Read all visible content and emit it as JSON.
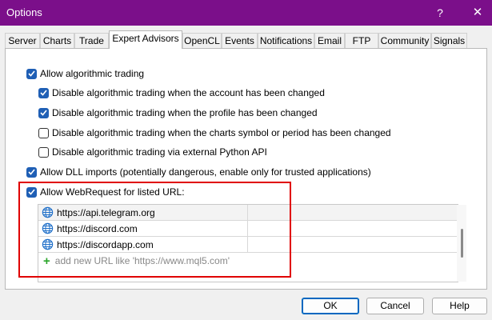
{
  "window": {
    "title": "Options",
    "help_glyph": "?",
    "close_glyph": "✕"
  },
  "tabs": [
    {
      "label": "Server"
    },
    {
      "label": "Charts"
    },
    {
      "label": "Trade"
    },
    {
      "label": "Expert Advisors",
      "active": true
    },
    {
      "label": "OpenCL"
    },
    {
      "label": "Events"
    },
    {
      "label": "Notifications"
    },
    {
      "label": "Email"
    },
    {
      "label": "FTP"
    },
    {
      "label": "Community"
    },
    {
      "label": "Signals"
    }
  ],
  "options": {
    "allow_algo": {
      "label": "Allow algorithmic trading",
      "checked": true
    },
    "disable_account": {
      "label": "Disable algorithmic trading when the account has been changed",
      "checked": true
    },
    "disable_profile": {
      "label": "Disable algorithmic trading when the profile has been changed",
      "checked": true
    },
    "disable_symbol": {
      "label": "Disable algorithmic trading when the charts symbol or period has been changed",
      "checked": false
    },
    "disable_python": {
      "label": "Disable algorithmic trading via external Python API",
      "checked": false
    },
    "allow_dll": {
      "label": "Allow DLL imports (potentially dangerous, enable only for trusted applications)",
      "checked": true
    },
    "allow_webrequest": {
      "label": "Allow WebRequest for listed URL:",
      "checked": true
    }
  },
  "url_list": {
    "urls": [
      "https://api.telegram.org",
      "https://discord.com",
      "https://discordapp.com"
    ],
    "add_placeholder": "add new URL like 'https://www.mql5.com'",
    "add_glyph": "+"
  },
  "buttons": {
    "ok": "OK",
    "cancel": "Cancel",
    "help": "Help"
  },
  "colors": {
    "titlebar": "#7b0f8a",
    "checkbox_on": "#1f5fb5",
    "highlight_box": "#e00000"
  }
}
